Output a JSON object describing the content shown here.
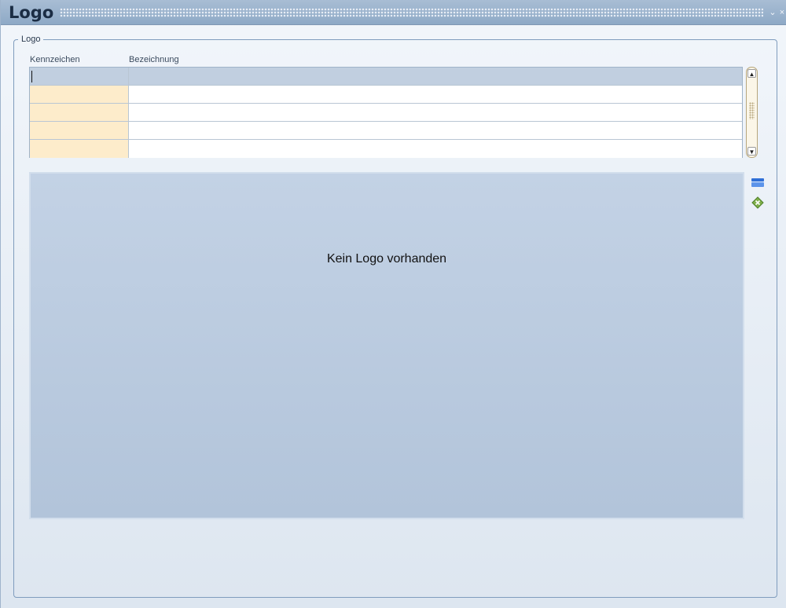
{
  "window": {
    "title": "Logo",
    "minimize_glyph": "⌄",
    "close_glyph": "×"
  },
  "group": {
    "label": "Logo"
  },
  "grid": {
    "columns": [
      "Kennzeichen",
      "Bezeichnung"
    ],
    "rows": [
      {
        "key": "",
        "desc": ""
      },
      {
        "key": "",
        "desc": ""
      },
      {
        "key": "",
        "desc": ""
      },
      {
        "key": "",
        "desc": ""
      },
      {
        "key": "",
        "desc": ""
      }
    ]
  },
  "logo": {
    "empty_text": "Kein Logo vorhanden"
  },
  "icons": {
    "open": "folder-open-icon",
    "delete": "delete-image-icon"
  },
  "colors": {
    "titlebar": "#8ea9c6",
    "key_cell": "#fdeccb",
    "selected_row": "#c1cfe0",
    "panel": "#b8c9de"
  }
}
